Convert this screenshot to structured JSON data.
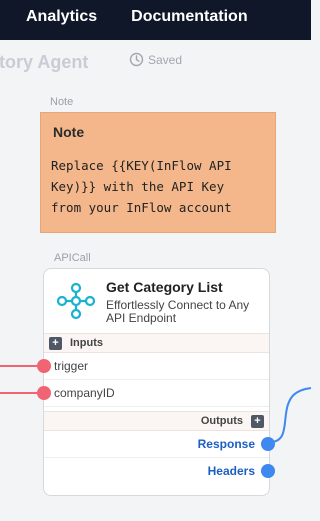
{
  "topnav": {
    "items": [
      {
        "label": "Analytics"
      },
      {
        "label": "Documentation"
      }
    ]
  },
  "flow": {
    "title": "ntory Agent",
    "status": "Saved"
  },
  "note_node": {
    "type_label": "Note",
    "title": "Note",
    "body_lines": [
      "Replace {{KEY(InFlow API",
      "Key)}} with the API Key",
      "from your InFlow account"
    ]
  },
  "api_node": {
    "type_label": "APICall",
    "title": "Get Category List",
    "description": "Effortlessly Connect to Any API Endpoint",
    "inputs_label": "Inputs",
    "inputs": [
      {
        "label": "trigger"
      },
      {
        "label": "companyID"
      }
    ],
    "outputs_label": "Outputs",
    "outputs": [
      {
        "label": "Response"
      },
      {
        "label": "Headers"
      }
    ]
  },
  "colors": {
    "topbar": "#0f1729",
    "note": "#f3b78b",
    "input_port": "#f06474",
    "output_port": "#3e88f0",
    "output_text": "#1c5fc4"
  },
  "icons": [
    "clock-icon",
    "api-network-icon",
    "plus-icon"
  ]
}
